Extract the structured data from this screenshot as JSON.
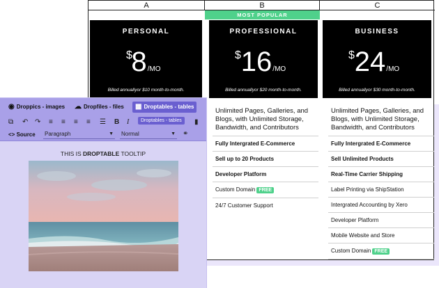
{
  "sheet": {
    "columns": [
      "A",
      "B",
      "C"
    ],
    "popular_label": "MOST POPULAR",
    "plans": [
      {
        "name": "PERSONAL",
        "currency": "$",
        "price": "8",
        "period": "/MO",
        "billed": "Billed annuallyor $10 month-to-month."
      },
      {
        "name": "PROFESSIONAL",
        "currency": "$",
        "price": "16",
        "period": "/MO",
        "billed": "Billed annuallyor $20 month-to-month."
      },
      {
        "name": "BUSINESS",
        "currency": "$",
        "price": "24",
        "period": "/MO",
        "billed": "Billed annuallyor $30 month-to-month."
      }
    ],
    "featuresB": {
      "intro": "Unlimited Pages, Galleries, and Blogs, with Unlimited Storage, Bandwidth, and Contributors",
      "f1": "Fully Intergrated E-Commerce",
      "f2": "Sell up to 20 Products",
      "f3": "Developer Platform",
      "f4": "Custom Domain",
      "f4_badge": "FREE",
      "f5": "24/7 Customer Support"
    },
    "featuresC": {
      "intro": "Unlimited Pages, Galleries, and Blogs, with Unlimited Storage, Bandwidth, and Contributors",
      "f1": "Fully Intergrated E-Commerce",
      "f2": "Sell Unlimited Products",
      "f3": "Real-Time Carrier Shipping",
      "f4": "Label Printing via ShipStation",
      "f5": "Intergrated Accounting by Xero",
      "f6": "Developer Platform",
      "f7": "Mobile Website and Store",
      "f8": "Custom Domain",
      "f8_badge": "FREE"
    }
  },
  "editor": {
    "tabs": {
      "images": "Droppics - images",
      "files": "Dropfiles - files",
      "tables": "Droptables - tables"
    },
    "tooltip_chip": "Droptables - tables",
    "source_label": "Source",
    "paragraph_value": "Paragraph",
    "size_value": "Normal",
    "content_title_pre": "THIS IS ",
    "content_title_bold": "DROPTABLE",
    "content_title_post": " TOOLTIP"
  },
  "colors": {
    "accent_green": "#4fd18b",
    "toolbar": "#a9a0e8",
    "active_tab": "#6a5fd0",
    "panel_bg": "#d9d4f5"
  },
  "icons": [
    "camera-icon",
    "cloud-icon",
    "table-icon",
    "expand-icon",
    "undo-icon",
    "redo-icon",
    "align-left-icon",
    "align-center-icon",
    "align-right-icon",
    "align-justify-icon",
    "list-icon",
    "bold-icon",
    "italic-icon",
    "code-icon",
    "link-icon"
  ]
}
